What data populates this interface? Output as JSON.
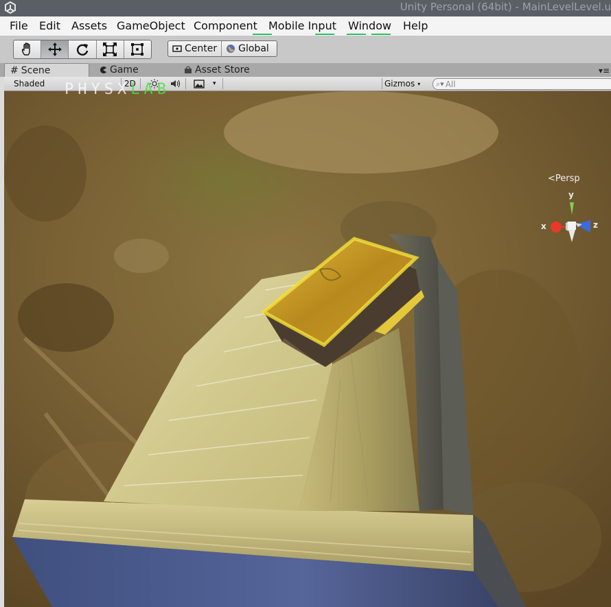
{
  "window": {
    "title": "Unity Personal (64bit) - MainLevelLevel.u"
  },
  "menu": {
    "items": [
      "File",
      "Edit",
      "Assets",
      "GameObject",
      "Component",
      "Mobile Input",
      "Window",
      "Help"
    ]
  },
  "toolbar": {
    "tools": [
      "hand-icon",
      "move-icon",
      "rotate-icon",
      "scale-icon",
      "rect-icon"
    ],
    "active_tool": "move-icon",
    "pivot_label": "Center",
    "space_label": "Global"
  },
  "tabs": {
    "scene": "Scene",
    "game": "Game",
    "asset_store": "Asset Store"
  },
  "scene_toolbar": {
    "shading_mode": "Shaded",
    "mode_2d": "2D",
    "gizmos_label": "Gizmos",
    "search_placeholder": "All"
  },
  "overlay": {
    "physx_white": "PHYSX",
    "physx_green": "LAB"
  },
  "gizmo": {
    "x": "x",
    "y": "y",
    "z": "z",
    "projection": "Persp"
  },
  "colors": {
    "axis_x": "#e8392a",
    "axis_y": "#7dd34a",
    "axis_z": "#3c6ad8",
    "menu_accent": "#27c45c"
  }
}
